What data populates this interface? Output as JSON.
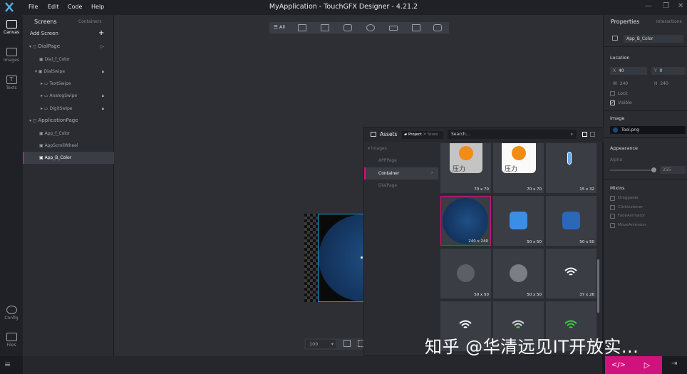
{
  "menu": [
    "File",
    "Edit",
    "Code",
    "Help"
  ],
  "app_title": "MyApplication - TouchGFX Designer - 4.21.2",
  "leftbar": {
    "canvas": "Canvas",
    "images": "Images",
    "texts": "Texts",
    "config": "Config",
    "files": "Files"
  },
  "screens": {
    "tab_screens": "Screens",
    "tab_containers": "Containers",
    "add_screen": "Add Screen",
    "add_icon": "+",
    "tree": [
      {
        "label": "DialPage",
        "level": 0
      },
      {
        "label": "Dial_f_Color",
        "level": 1
      },
      {
        "label": "DialSwipe",
        "level": 1
      },
      {
        "label": "TextSwipe",
        "level": 2
      },
      {
        "label": "AnalogSwipe",
        "level": 2
      },
      {
        "label": "DigitSwipe",
        "level": 2
      },
      {
        "label": "ApplicationPage",
        "level": 0
      },
      {
        "label": "App_f_Color",
        "level": 1
      },
      {
        "label": "AppScrollWheel",
        "level": 1
      },
      {
        "label": "App_B_Color",
        "level": 1,
        "selected": true
      }
    ]
  },
  "toolbar": {
    "all": "All"
  },
  "properties": {
    "tab_properties": "Properties",
    "tab_interactions": "Interactions",
    "name": "App_B_Color",
    "location": "Location",
    "x_label": "X",
    "x_value": "40",
    "y_label": "Y",
    "y_value": "0",
    "w_label": "W",
    "w_value": "240",
    "h_label": "H",
    "h_value": "240",
    "lock": "Lock",
    "visible": "Visible",
    "image_section": "Image",
    "image_value": "Tool.png",
    "appearance": "Appearance",
    "alpha": "Alpha",
    "alpha_value": "255",
    "alpha_fraction": 1.0,
    "mixins": "Mixins",
    "mixin_items": [
      "Draggable",
      "ClickListener",
      "FadeAnimator",
      "MoveAnimator"
    ]
  },
  "assets": {
    "title": "Assets",
    "tab_project": "Project",
    "tab_store": "Store",
    "search_placeholder": "Search...",
    "images_folder": "Images",
    "folders": [
      "APPPage",
      "Container",
      "DialPage"
    ],
    "tiles": [
      {
        "size": "70 x 70",
        "kind": "gauge-grey",
        "text": "压力"
      },
      {
        "size": "70 x 70",
        "kind": "gauge-white",
        "text": "压力"
      },
      {
        "size": "15 x 32",
        "kind": "thermo"
      },
      {
        "size": "240 x 240",
        "kind": "circle",
        "selected": true
      },
      {
        "size": "50 x 50",
        "kind": "blue-chip"
      },
      {
        "size": "50 x 50",
        "kind": "blue-chip-dark"
      },
      {
        "size": "50 x 50",
        "kind": "grey-u"
      },
      {
        "size": "50 x 50",
        "kind": "grey-u-light"
      },
      {
        "size": "37 x 26",
        "kind": "wifi-white"
      },
      {
        "size": "",
        "kind": "wifi-white"
      },
      {
        "size": "",
        "kind": "wifi-green"
      },
      {
        "size": "",
        "kind": "wifi-green-bright"
      }
    ]
  },
  "zoom": "100",
  "watermark": "知乎 @华清远见IT开放实..."
}
